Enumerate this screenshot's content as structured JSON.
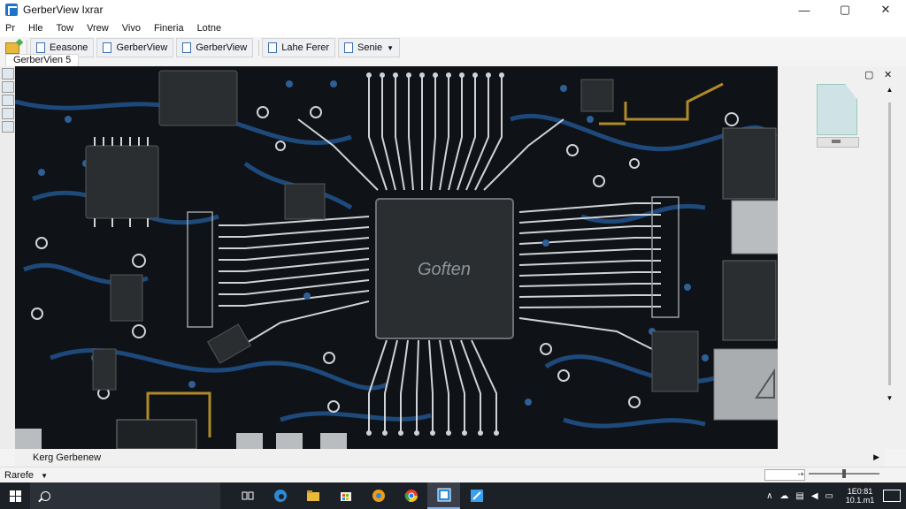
{
  "window": {
    "title": "GerberView Ixrar",
    "controls": {
      "minimize": "—",
      "maximize": "▢",
      "close": "✕"
    }
  },
  "menu": [
    "Pr",
    "Hle",
    "Tow",
    "Vrew",
    "Vivo",
    "Fineria",
    "Lotne"
  ],
  "toolbar": {
    "buttons": [
      "Eeasone",
      "GerberView",
      "GerberView",
      "Lahe Ferer",
      "Senie"
    ]
  },
  "document_tab": "GerberVien 5",
  "canvas": {
    "chip_label": "Goften"
  },
  "right_panel": {
    "restore": "▢",
    "close": "✕"
  },
  "status": {
    "hscroll_text": "Kerg Gerbenew",
    "dropdown": "Rarefe",
    "coord": "-+"
  },
  "taskbar": {
    "clock_time": "1E0:81",
    "clock_date": "10.1.m1"
  },
  "colors": {
    "board": "#0f1216",
    "trace_blue": "#1f4f86",
    "trace_silver": "#cfd3d6",
    "trace_gold": "#b08a2a",
    "chip": "#2a2e31"
  }
}
